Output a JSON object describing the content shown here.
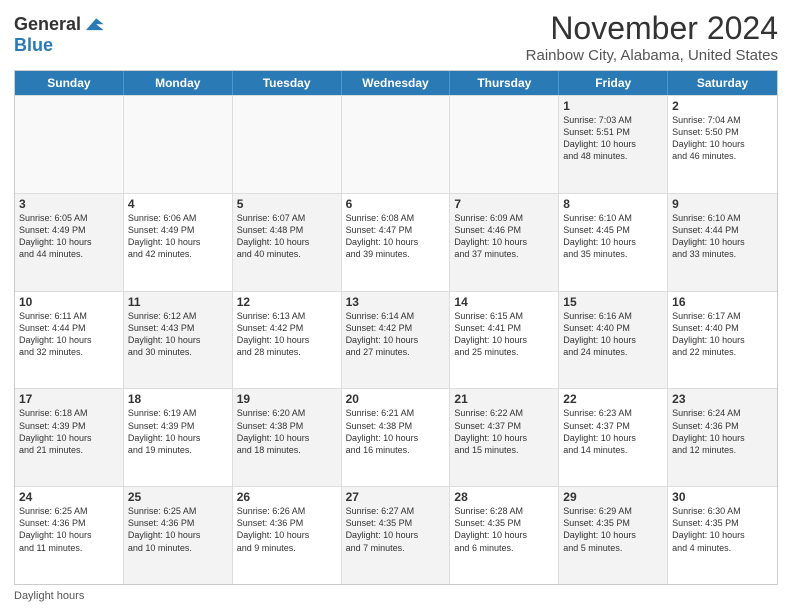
{
  "logo": {
    "line1": "General",
    "line2": "Blue"
  },
  "title": "November 2024",
  "subtitle": "Rainbow City, Alabama, United States",
  "footer": "Daylight hours",
  "weekdays": [
    "Sunday",
    "Monday",
    "Tuesday",
    "Wednesday",
    "Thursday",
    "Friday",
    "Saturday"
  ],
  "rows": [
    [
      {
        "day": "",
        "text": "",
        "empty": true
      },
      {
        "day": "",
        "text": "",
        "empty": true
      },
      {
        "day": "",
        "text": "",
        "empty": true
      },
      {
        "day": "",
        "text": "",
        "empty": true
      },
      {
        "day": "",
        "text": "",
        "empty": true
      },
      {
        "day": "1",
        "text": "Sunrise: 7:03 AM\nSunset: 5:51 PM\nDaylight: 10 hours\nand 48 minutes.",
        "shaded": true
      },
      {
        "day": "2",
        "text": "Sunrise: 7:04 AM\nSunset: 5:50 PM\nDaylight: 10 hours\nand 46 minutes.",
        "shaded": false
      }
    ],
    [
      {
        "day": "3",
        "text": "Sunrise: 6:05 AM\nSunset: 4:49 PM\nDaylight: 10 hours\nand 44 minutes.",
        "shaded": true
      },
      {
        "day": "4",
        "text": "Sunrise: 6:06 AM\nSunset: 4:49 PM\nDaylight: 10 hours\nand 42 minutes.",
        "shaded": false
      },
      {
        "day": "5",
        "text": "Sunrise: 6:07 AM\nSunset: 4:48 PM\nDaylight: 10 hours\nand 40 minutes.",
        "shaded": true
      },
      {
        "day": "6",
        "text": "Sunrise: 6:08 AM\nSunset: 4:47 PM\nDaylight: 10 hours\nand 39 minutes.",
        "shaded": false
      },
      {
        "day": "7",
        "text": "Sunrise: 6:09 AM\nSunset: 4:46 PM\nDaylight: 10 hours\nand 37 minutes.",
        "shaded": true
      },
      {
        "day": "8",
        "text": "Sunrise: 6:10 AM\nSunset: 4:45 PM\nDaylight: 10 hours\nand 35 minutes.",
        "shaded": false
      },
      {
        "day": "9",
        "text": "Sunrise: 6:10 AM\nSunset: 4:44 PM\nDaylight: 10 hours\nand 33 minutes.",
        "shaded": true
      }
    ],
    [
      {
        "day": "10",
        "text": "Sunrise: 6:11 AM\nSunset: 4:44 PM\nDaylight: 10 hours\nand 32 minutes.",
        "shaded": false
      },
      {
        "day": "11",
        "text": "Sunrise: 6:12 AM\nSunset: 4:43 PM\nDaylight: 10 hours\nand 30 minutes.",
        "shaded": true
      },
      {
        "day": "12",
        "text": "Sunrise: 6:13 AM\nSunset: 4:42 PM\nDaylight: 10 hours\nand 28 minutes.",
        "shaded": false
      },
      {
        "day": "13",
        "text": "Sunrise: 6:14 AM\nSunset: 4:42 PM\nDaylight: 10 hours\nand 27 minutes.",
        "shaded": true
      },
      {
        "day": "14",
        "text": "Sunrise: 6:15 AM\nSunset: 4:41 PM\nDaylight: 10 hours\nand 25 minutes.",
        "shaded": false
      },
      {
        "day": "15",
        "text": "Sunrise: 6:16 AM\nSunset: 4:40 PM\nDaylight: 10 hours\nand 24 minutes.",
        "shaded": true
      },
      {
        "day": "16",
        "text": "Sunrise: 6:17 AM\nSunset: 4:40 PM\nDaylight: 10 hours\nand 22 minutes.",
        "shaded": false
      }
    ],
    [
      {
        "day": "17",
        "text": "Sunrise: 6:18 AM\nSunset: 4:39 PM\nDaylight: 10 hours\nand 21 minutes.",
        "shaded": true
      },
      {
        "day": "18",
        "text": "Sunrise: 6:19 AM\nSunset: 4:39 PM\nDaylight: 10 hours\nand 19 minutes.",
        "shaded": false
      },
      {
        "day": "19",
        "text": "Sunrise: 6:20 AM\nSunset: 4:38 PM\nDaylight: 10 hours\nand 18 minutes.",
        "shaded": true
      },
      {
        "day": "20",
        "text": "Sunrise: 6:21 AM\nSunset: 4:38 PM\nDaylight: 10 hours\nand 16 minutes.",
        "shaded": false
      },
      {
        "day": "21",
        "text": "Sunrise: 6:22 AM\nSunset: 4:37 PM\nDaylight: 10 hours\nand 15 minutes.",
        "shaded": true
      },
      {
        "day": "22",
        "text": "Sunrise: 6:23 AM\nSunset: 4:37 PM\nDaylight: 10 hours\nand 14 minutes.",
        "shaded": false
      },
      {
        "day": "23",
        "text": "Sunrise: 6:24 AM\nSunset: 4:36 PM\nDaylight: 10 hours\nand 12 minutes.",
        "shaded": true
      }
    ],
    [
      {
        "day": "24",
        "text": "Sunrise: 6:25 AM\nSunset: 4:36 PM\nDaylight: 10 hours\nand 11 minutes.",
        "shaded": false
      },
      {
        "day": "25",
        "text": "Sunrise: 6:25 AM\nSunset: 4:36 PM\nDaylight: 10 hours\nand 10 minutes.",
        "shaded": true
      },
      {
        "day": "26",
        "text": "Sunrise: 6:26 AM\nSunset: 4:36 PM\nDaylight: 10 hours\nand 9 minutes.",
        "shaded": false
      },
      {
        "day": "27",
        "text": "Sunrise: 6:27 AM\nSunset: 4:35 PM\nDaylight: 10 hours\nand 7 minutes.",
        "shaded": true
      },
      {
        "day": "28",
        "text": "Sunrise: 6:28 AM\nSunset: 4:35 PM\nDaylight: 10 hours\nand 6 minutes.",
        "shaded": false
      },
      {
        "day": "29",
        "text": "Sunrise: 6:29 AM\nSunset: 4:35 PM\nDaylight: 10 hours\nand 5 minutes.",
        "shaded": true
      },
      {
        "day": "30",
        "text": "Sunrise: 6:30 AM\nSunset: 4:35 PM\nDaylight: 10 hours\nand 4 minutes.",
        "shaded": false
      }
    ]
  ]
}
